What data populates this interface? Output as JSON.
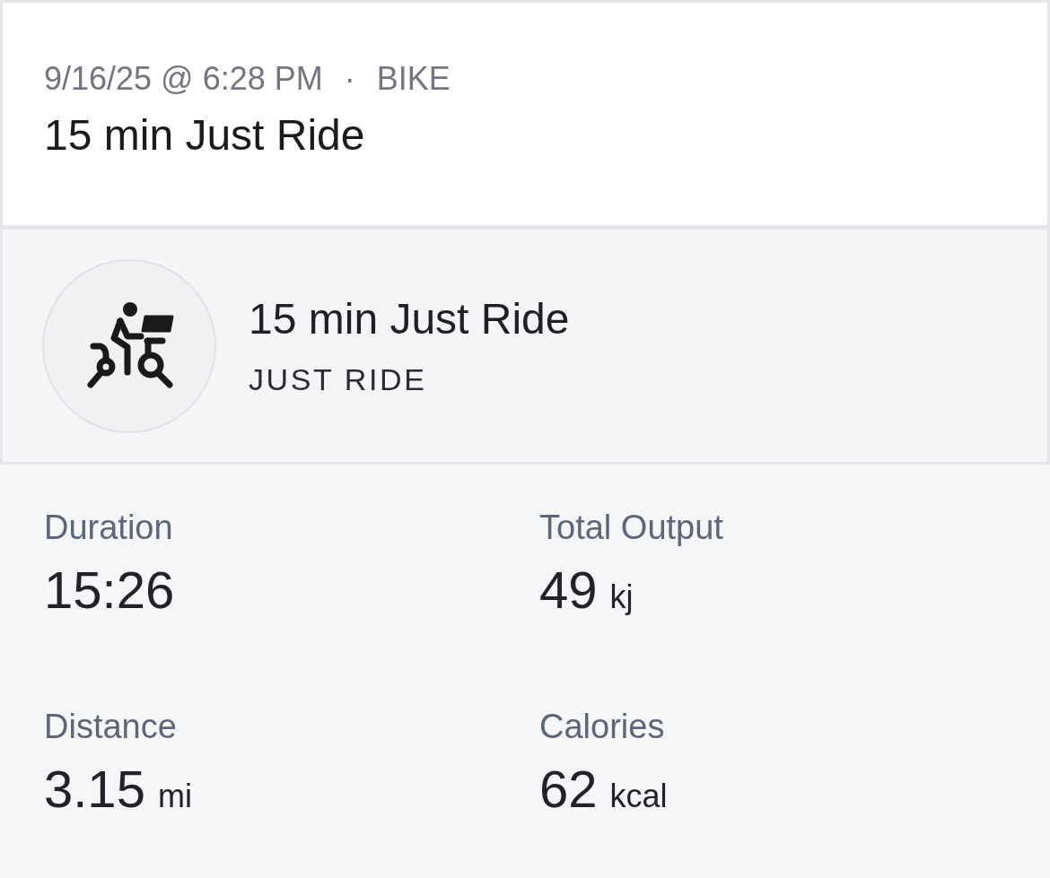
{
  "header": {
    "date_time": "9/16/25 @ 6:28 PM",
    "separator": "·",
    "category": "BIKE",
    "title": "15 min Just Ride"
  },
  "class_card": {
    "title": "15 min Just Ride",
    "class_type": "JUST RIDE"
  },
  "stats": [
    {
      "label": "Duration",
      "value": "15:26"
    },
    {
      "label": "Total Output",
      "value": "49",
      "unit": "kj"
    },
    {
      "label": "Distance",
      "value": "3.15",
      "unit": "mi"
    },
    {
      "label": "Calories",
      "value": "62",
      "unit": "kcal"
    }
  ]
}
